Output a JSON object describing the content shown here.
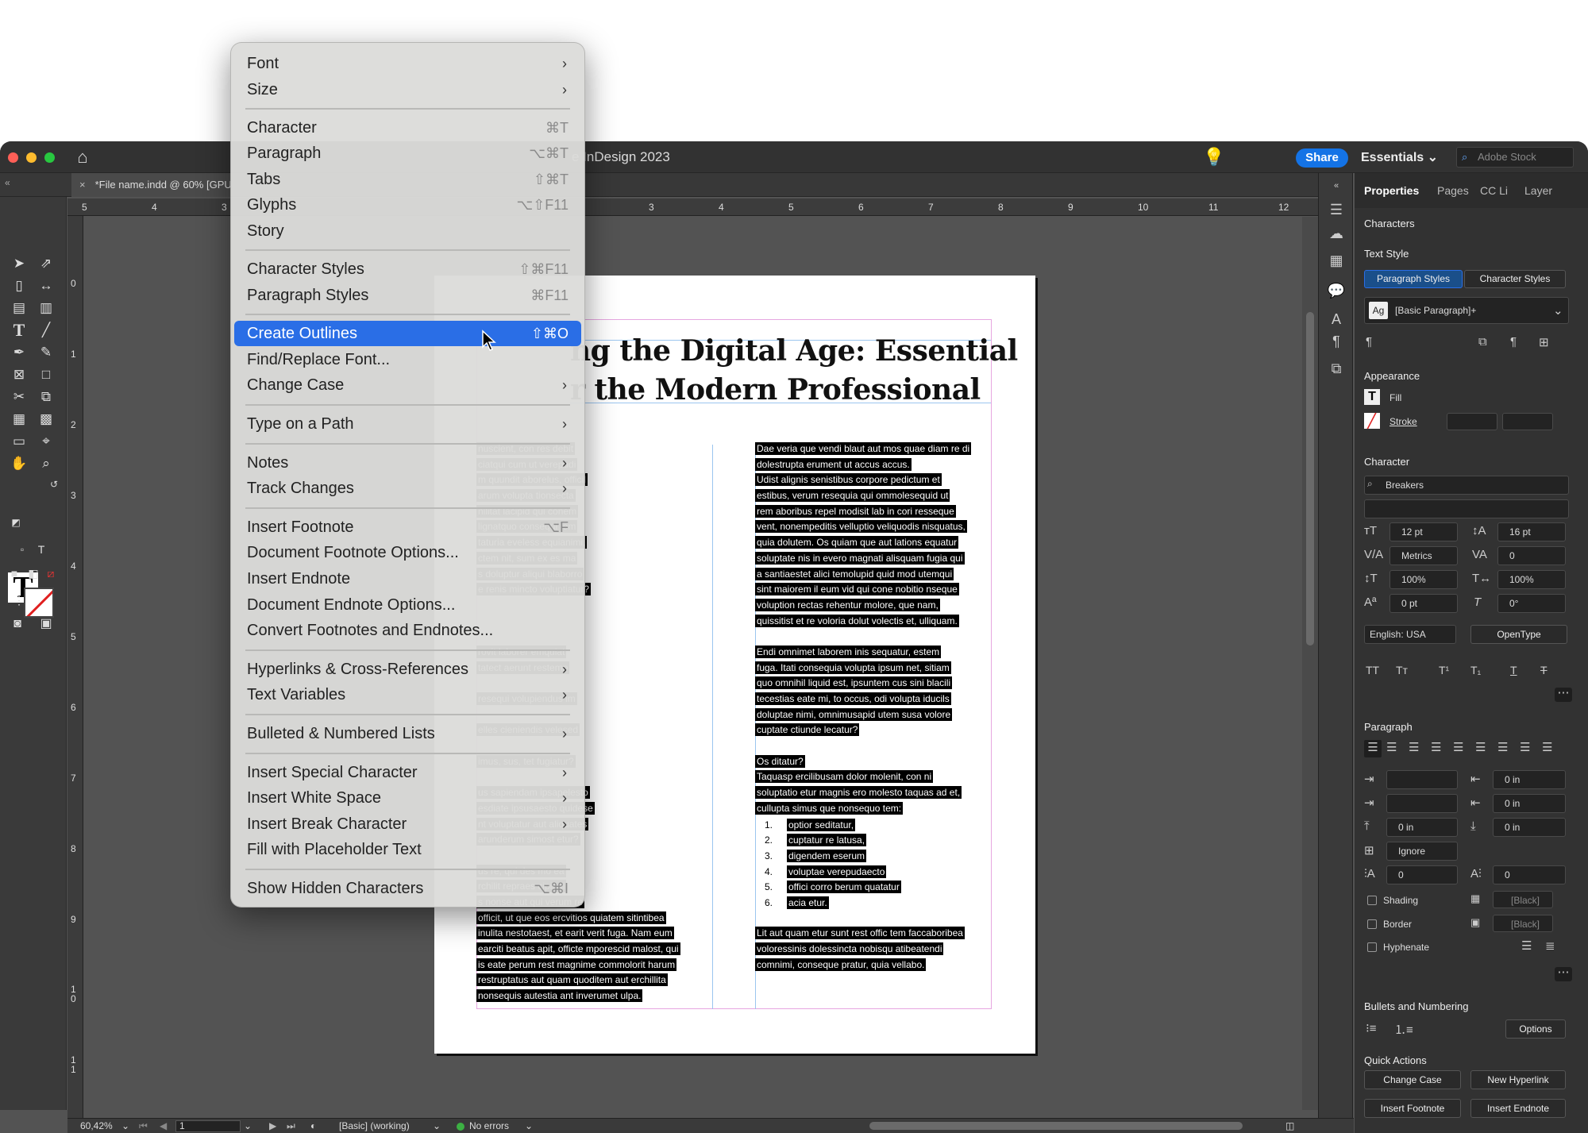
{
  "app": {
    "title": "Adobe InDesign 2023",
    "title_partial": "e InDesign 2023",
    "share_label": "Share",
    "workspace": "Essentials",
    "search_placeholder": "Adobe Stock",
    "doc_tab": "*File name.indd @ 60% [GPU"
  },
  "ruler": {
    "h_ticks": [
      "5",
      "4",
      "3",
      "3",
      "4",
      "5",
      "6",
      "7",
      "8",
      "9",
      "10",
      "11",
      "12"
    ],
    "v_ticks": [
      "0",
      "1",
      "2",
      "3",
      "4",
      "5",
      "6",
      "7",
      "8",
      "9",
      "1 0",
      "1 1"
    ]
  },
  "document": {
    "headline_line1": "ng the Digital Age: Essential",
    "headline_line2": "r the Modern Professional",
    "left_column": [
      "nuscient, con res debit",
      "ciatqui cum ut verepudi",
      "m quundit aborelus, officil",
      "arum volupta tionsecta",
      "nilitat lacipid qui conem",
      "lignatquo consequi tem",
      "taturia eveless equianimi,",
      "ctem nit, sum ex es ma",
      "s doluptur aliqui blaborro",
      "e renis mincto voluptiatur?",
      "",
      "",
      "",
      "rovit laborer emquiat",
      "tatect aerunt restemp",
      "",
      "resequi volupiendus im",
      "",
      "elles cieniendis velesed",
      "",
      "imus, sus, tet fugiatur?",
      "",
      "us sapiendam ipsapelesto",
      "esdiate ipsusaesto quidese",
      "nt voluptatur aut aliquates",
      "arunderum simost etur?",
      "",
      "us re, qui des mo ea",
      "rchilit repraes cipieni",
      "s nonse aut qui verum re",
      "officit, ut que eos ercvitios quiatem sitintibea",
      "inulita nestotaest, et earit verit fuga. Nam eum",
      "earciti beatus apit, officte mporescid malost, qui",
      "is eate perum rest magnime commolorit harum",
      "restruptatus aut quam quoditem aut erchillita",
      "nonsequis autestia ant inverumet ulpa."
    ],
    "right_column": [
      "Dae veria que vendi blaut aut mos quae diam re di",
      "dolestrupta erument ut accus accus.",
      "Udist alignis senistibus corpore pedictum et",
      "estibus, verum resequia qui ommolesequid ut",
      "rem aboribus repel modisit lab in cori resseque",
      "vent, nonempeditis velluptio veliquodis nisquatus,",
      "quia dolutem. Os quiam que aut lations equatur",
      "soluptate nis in evero magnati alisquam fugia qui",
      "a santiaestet alici temolupid quid mod utemqui",
      "sint maiorem il eum vid qui cone nobitio nseque",
      "voluption rectas rehentur molore, que nam,",
      "quissitist et re voloria dolut volectis et, ulliquam.",
      "",
      "Endi omnimet laborem inis sequatur, estem",
      "fuga. Itati consequia volupta ipsum net, sitiam",
      "quo omnihil liquid est, ipsuntem cus sini blacili",
      "tecestias eate mi, to occus, odi volupta iducils",
      "doluptae nimi, omnimusapid utem susa volore",
      "cuptate ctiunde lecatur?",
      "",
      "Os ditatur?",
      "Taquasp ercilibusam dolor molenit, con ni",
      "soluptatio etur magnis ero molesto taquas ad et,",
      "cullupta simus que nonsequo tem:"
    ],
    "list": [
      {
        "n": "1.",
        "t": "optior seditatur,"
      },
      {
        "n": "2.",
        "t": "cuptatur re latusa,"
      },
      {
        "n": "3.",
        "t": "digendem eserum"
      },
      {
        "n": "4.",
        "t": "voluptae verepudaecto"
      },
      {
        "n": "5.",
        "t": "offici corro berum quatatur"
      },
      {
        "n": "6.",
        "t": "acia etur."
      }
    ],
    "right_tail": [
      "Lit aut quam etur sunt rest offic tem faccaboribea",
      "voloressinis dolessincta nobisqu atibeatendi",
      "comnimi, conseque pratur, quia vellabo."
    ]
  },
  "context_menu": {
    "items": [
      {
        "label": "Font",
        "submenu": true
      },
      {
        "label": "Size",
        "submenu": true
      },
      {
        "sep": true
      },
      {
        "label": "Character",
        "shortcut": "⌘T"
      },
      {
        "label": "Paragraph",
        "shortcut": "⌥⌘T"
      },
      {
        "label": "Tabs",
        "shortcut": "⇧⌘T"
      },
      {
        "label": "Glyphs",
        "shortcut": "⌥⇧F11"
      },
      {
        "label": "Story"
      },
      {
        "sep": true
      },
      {
        "label": "Character Styles",
        "shortcut": "⇧⌘F11"
      },
      {
        "label": "Paragraph Styles",
        "shortcut": "⌘F11"
      },
      {
        "sep": true
      },
      {
        "label": "Create Outlines",
        "shortcut": "⇧⌘O",
        "highlighted": true
      },
      {
        "label": "Find/Replace Font..."
      },
      {
        "label": "Change Case",
        "submenu": true
      },
      {
        "sep": true
      },
      {
        "label": "Type on a Path",
        "submenu": true
      },
      {
        "sep": true
      },
      {
        "label": "Notes",
        "submenu": true
      },
      {
        "label": "Track Changes",
        "submenu": true
      },
      {
        "sep": true
      },
      {
        "label": "Insert Footnote",
        "shortcut": "⌥F"
      },
      {
        "label": "Document Footnote Options..."
      },
      {
        "label": "Insert Endnote"
      },
      {
        "label": "Document Endnote Options..."
      },
      {
        "label": "Convert Footnotes and Endnotes..."
      },
      {
        "sep": true
      },
      {
        "label": "Hyperlinks & Cross-References",
        "submenu": true
      },
      {
        "label": "Text Variables",
        "submenu": true
      },
      {
        "sep": true
      },
      {
        "label": "Bulleted & Numbered Lists",
        "submenu": true
      },
      {
        "sep": true
      },
      {
        "label": "Insert Special Character",
        "submenu": true
      },
      {
        "label": "Insert White Space",
        "submenu": true
      },
      {
        "label": "Insert Break Character",
        "submenu": true
      },
      {
        "label": "Fill with Placeholder Text"
      },
      {
        "sep": true
      },
      {
        "label": "Show Hidden Characters",
        "shortcut": "⌥⌘I"
      }
    ]
  },
  "properties": {
    "tabs": [
      "Properties",
      "Pages",
      "CC Li",
      "Layer"
    ],
    "characters_heading": "Characters",
    "text_style_heading": "Text Style",
    "paragraph_styles_btn": "Paragraph Styles",
    "character_styles_btn": "Character Styles",
    "style_value": "[Basic Paragraph]+",
    "appearance_heading": "Appearance",
    "fill_label": "Fill",
    "stroke_label": "Stroke",
    "character_heading": "Character",
    "font_family": "Breakers",
    "font_size": "12 pt",
    "leading": "16 pt",
    "kerning": "Metrics",
    "tracking": "0",
    "vert_scale": "100%",
    "horiz_scale": "100%",
    "baseline": "0 pt",
    "skew": "0°",
    "language": "English: USA",
    "opentype_btn": "OpenType",
    "paragraph_heading": "Paragraph",
    "right_indent": "0 in",
    "last_indent": "0 in",
    "space_before": "0 in",
    "space_after": "0 in",
    "align_to_grid": "Ignore",
    "drop_cap_lines": "0",
    "drop_cap_chars": "0",
    "shading_label": "Shading",
    "border_label": "Border",
    "hyphenate_label": "Hyphenate",
    "swatch_black": "[Black]",
    "bullets_heading": "Bullets and Numbering",
    "options_btn": "Options",
    "quick_actions_heading": "Quick Actions",
    "change_case_btn": "Change Case",
    "new_hyperlink_btn": "New Hyperlink",
    "insert_footnote_btn": "Insert Footnote",
    "insert_endnote_btn": "Insert Endnote"
  },
  "status": {
    "zoom": "60,42%",
    "page": "1",
    "style": "[Basic] (working)",
    "errors": "No errors"
  },
  "colors": {
    "accent": "#1473e6",
    "menu_highlight": "#2a6ee6",
    "status_ok": "#3cb043"
  }
}
